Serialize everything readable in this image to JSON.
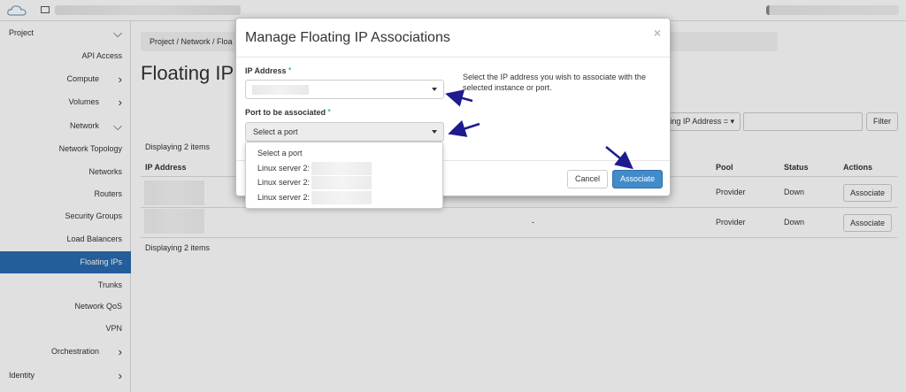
{
  "sidebar": {
    "items": [
      {
        "label": "Project",
        "level": 0,
        "chevron": "chevron-down"
      },
      {
        "label": "API Access",
        "level": 2
      },
      {
        "label": "Compute",
        "level": 1,
        "chevron": "chevron-right"
      },
      {
        "label": "Volumes",
        "level": 1,
        "chevron": "chevron-right"
      },
      {
        "label": "Network",
        "level": 1,
        "chevron": "chevron-down"
      },
      {
        "label": "Network Topology",
        "level": 2
      },
      {
        "label": "Networks",
        "level": 2
      },
      {
        "label": "Routers",
        "level": 2
      },
      {
        "label": "Security Groups",
        "level": 2
      },
      {
        "label": "Load Balancers",
        "level": 2
      },
      {
        "label": "Floating IPs",
        "level": 2,
        "active": true
      },
      {
        "label": "Trunks",
        "level": 2
      },
      {
        "label": "Network QoS",
        "level": 2
      },
      {
        "label": "VPN",
        "level": 2
      },
      {
        "label": "Orchestration",
        "level": 1,
        "chevron": "chevron-right"
      },
      {
        "label": "Identity",
        "level": 0,
        "chevron": "chevron-right"
      }
    ],
    "active_color": "#2a6bb0"
  },
  "breadcrumb": {
    "text": "Project /  Network /  Floa"
  },
  "page": {
    "title": "Floating IP",
    "filter_select": "ting IP Address = ▾",
    "filter_button": "Filter",
    "count_top": "Displaying 2 items",
    "count_bottom": "Displaying 2 items"
  },
  "table": {
    "headers": {
      "ip": "IP Address",
      "pool": "Pool",
      "status": "Status",
      "actions": "Actions"
    },
    "rows": [
      {
        "mapped": "",
        "pool": "Provider",
        "status": "Down",
        "action": "Associate"
      },
      {
        "mapped": "-",
        "pool": "Provider",
        "status": "Down",
        "action": "Associate"
      }
    ]
  },
  "modal": {
    "title": "Manage Floating IP Associations",
    "close": "×",
    "ip_label": "IP Address",
    "required_mark": "*",
    "port_label": "Port to be associated",
    "port_placeholder": "Select a port",
    "help_text": "Select the IP address you wish to associate with the selected instance or port.",
    "cancel_label": "Cancel",
    "associate_label": "Associate",
    "associate_color": "#428bca"
  },
  "dropdown": {
    "options": [
      "Select a port",
      "Linux server 2:",
      "Linux server 2:",
      "Linux server 2:"
    ]
  },
  "annotations": {
    "arrow_color": "#1f1a8f"
  }
}
